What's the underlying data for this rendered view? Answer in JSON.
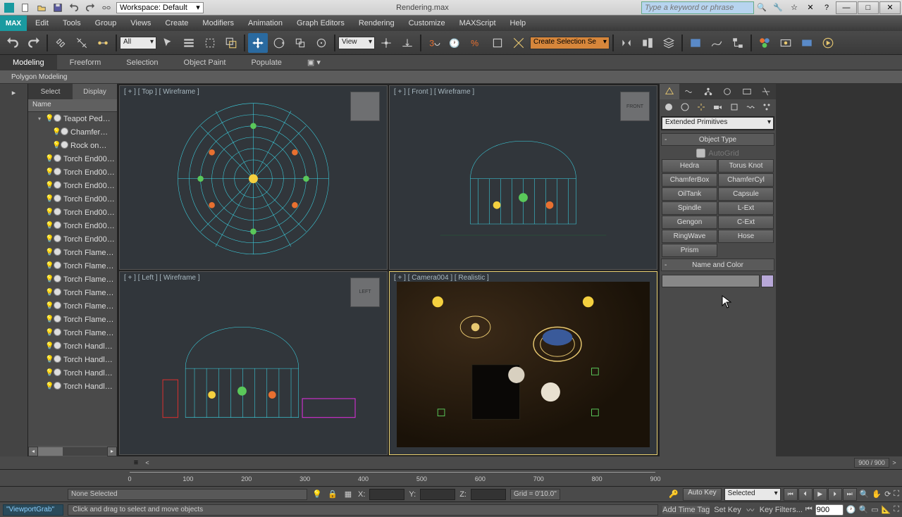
{
  "titlebar": {
    "workspace_label": "Workspace: Default",
    "filename": "Rendering.max",
    "search_placeholder": "Type a keyword or phrase"
  },
  "menus": [
    "Edit",
    "Tools",
    "Group",
    "Views",
    "Create",
    "Modifiers",
    "Animation",
    "Graph Editors",
    "Rendering",
    "Customize",
    "MAXScript",
    "Help"
  ],
  "logo": "MAX",
  "toolbar": {
    "filter_dd": "All",
    "refcoord_dd": "View",
    "named_sel": "Create Selection Se"
  },
  "ribbon": {
    "tabs": [
      "Modeling",
      "Freeform",
      "Selection",
      "Object Paint",
      "Populate"
    ],
    "active": 0,
    "sub": "Polygon Modeling"
  },
  "scene": {
    "tabs": [
      "Select",
      "Display"
    ],
    "active": 0,
    "header": "Name",
    "items": [
      {
        "indent": 1,
        "twist": "▾",
        "name": "Teapot Ped…"
      },
      {
        "indent": 2,
        "name": "Chamfer…"
      },
      {
        "indent": 2,
        "name": "Rock on…"
      },
      {
        "indent": 1,
        "name": "Torch End00…"
      },
      {
        "indent": 1,
        "name": "Torch End00…"
      },
      {
        "indent": 1,
        "name": "Torch End00…"
      },
      {
        "indent": 1,
        "name": "Torch End00…"
      },
      {
        "indent": 1,
        "name": "Torch End00…"
      },
      {
        "indent": 1,
        "name": "Torch End00…"
      },
      {
        "indent": 1,
        "name": "Torch End00…"
      },
      {
        "indent": 1,
        "name": "Torch Flame…"
      },
      {
        "indent": 1,
        "name": "Torch Flame…"
      },
      {
        "indent": 1,
        "name": "Torch Flame…"
      },
      {
        "indent": 1,
        "name": "Torch Flame…"
      },
      {
        "indent": 1,
        "name": "Torch Flame…"
      },
      {
        "indent": 1,
        "name": "Torch Flame…"
      },
      {
        "indent": 1,
        "name": "Torch Flame…"
      },
      {
        "indent": 1,
        "name": "Torch Handl…"
      },
      {
        "indent": 1,
        "name": "Torch Handl…"
      },
      {
        "indent": 1,
        "name": "Torch Handl…"
      },
      {
        "indent": 1,
        "name": "Torch Handl…"
      }
    ]
  },
  "viewports": {
    "tl": "[ + ] [ Top ] [ Wireframe ]",
    "tr": "[ + ] [ Front ] [ Wireframe ]",
    "bl": "[ + ] [ Left ] [ Wireframe ]",
    "br": "[ + ] [ Camera004 ] [ Realistic ]",
    "cube_left": "LEFT",
    "cube_front": "FRONT"
  },
  "cmd": {
    "category": "Extended Primitives",
    "rollout1": "Object Type",
    "autogrid": "AutoGrid",
    "buttons": [
      "Hedra",
      "Torus Knot",
      "ChamferBox",
      "ChamferCyl",
      "OilTank",
      "Capsule",
      "Spindle",
      "L-Ext",
      "Gengon",
      "C-Ext",
      "RingWave",
      "Hose",
      "Prism"
    ],
    "rollout2": "Name and Color"
  },
  "timeline": {
    "frame_display": "900 / 900",
    "ticks": [
      "0",
      "100",
      "200",
      "300",
      "400",
      "500",
      "600",
      "700",
      "800",
      "900"
    ]
  },
  "status": {
    "selection": "None Selected",
    "x": "X:",
    "y": "Y:",
    "z": "Z:",
    "grid": "Grid = 0'10.0\"",
    "autokey": "Auto Key",
    "selected_dd": "Selected",
    "setkey": "Set Key",
    "keyfilters": "Key Filters...",
    "frame": "900"
  },
  "prompt": {
    "script": "\"ViewportGrab\"",
    "msg": "Click and drag to select and move objects",
    "timetag": "Add Time Tag"
  }
}
